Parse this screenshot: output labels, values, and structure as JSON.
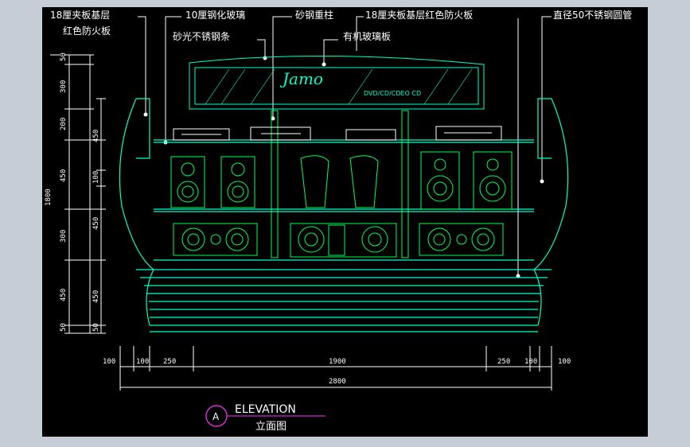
{
  "labels": {
    "top_left_1": "18厘夹板基层",
    "top_left_2": "红色防火板",
    "glass10": "10厘钢化玻璃",
    "sand_strip": "砂光不锈钢条",
    "sand_column": "砂钢重柱",
    "acrylic": "有机玻璃板",
    "top_right": "18厘夹板基层红色防火板",
    "steel_pipe": "直径50不锈钢圆管"
  },
  "sign": {
    "brand": "Jamo",
    "sub": "DVD/CD/CDEO CD"
  },
  "dims": {
    "left_outer": [
      "50",
      "300",
      "200",
      "450",
      "300",
      "450",
      "50"
    ],
    "left_inner": [
      "450",
      "100",
      "450",
      "450",
      "50"
    ],
    "left_total": "1800",
    "bottom_row": [
      "100",
      "100",
      "250",
      "1900",
      "250",
      "100",
      "100"
    ],
    "bottom_total": "2800"
  },
  "title": {
    "marker": "A",
    "main": "ELEVATION",
    "sub": "立面图"
  },
  "colors": {
    "bg": "#000000",
    "outline": "#00ffcc",
    "speaker": "#00ff55",
    "label": "#ffffff",
    "marker": "#ff33ff"
  }
}
